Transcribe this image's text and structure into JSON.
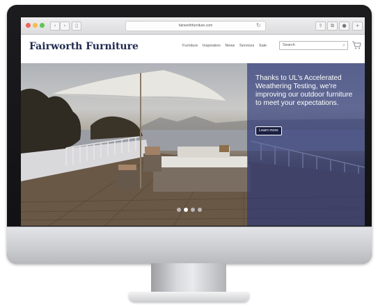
{
  "browser": {
    "url": "fairworthfurniture.com",
    "reload_icon": "reload-icon",
    "nav_icons": [
      "back-icon",
      "forward-icon",
      "sidebar-icon"
    ],
    "toolbar_icons": [
      "share-icon",
      "tabs-icon",
      "extension-icon",
      "add-tab-icon"
    ]
  },
  "site": {
    "logo": "Fairworth Furniture",
    "nav": [
      "Furniture",
      "Inspiration",
      "News",
      "Services",
      "Sale"
    ],
    "search_placeholder": "Search",
    "cart_icon": "cart-icon",
    "brand_color": "#1f2a4f"
  },
  "hero": {
    "headline": "Thanks to UL's Accelerated Weathering Testing, we're improving our outdoor furniture to meet your expectations.",
    "cta": "Learn more",
    "overlay_color": "#2a3778",
    "carousel": {
      "count": 4,
      "active": 1
    }
  }
}
